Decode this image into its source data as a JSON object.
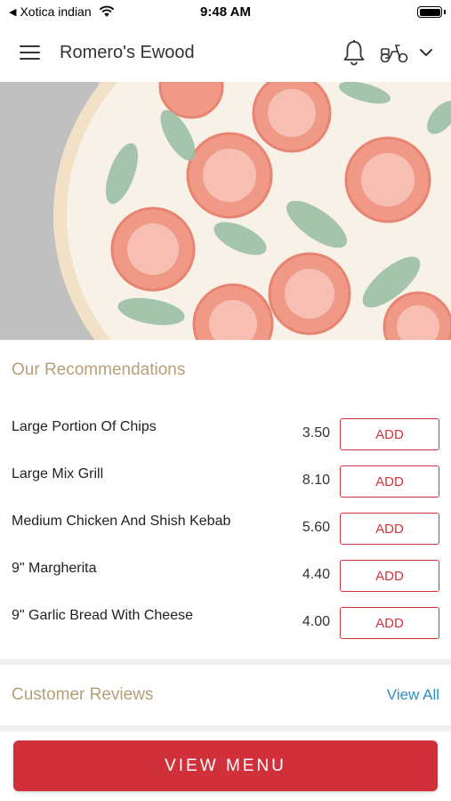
{
  "status_bar": {
    "back_label": "Xotica indian",
    "time": "9:48 AM",
    "battery_level": 1.0
  },
  "header": {
    "title": "Romero's Ewood",
    "icons": [
      "menu-icon",
      "bell-icon",
      "scooter-icon",
      "chevron-down-icon"
    ]
  },
  "recommendations": {
    "title": "Our Recommendations",
    "items": [
      {
        "name": "Large Portion Of Chips",
        "price": "3.50",
        "button": "ADD"
      },
      {
        "name": "Large Mix Grill",
        "price": "8.10",
        "button": "ADD"
      },
      {
        "name": "Medium Chicken And Shish Kebab",
        "price": "5.60",
        "button": "ADD"
      },
      {
        "name": "9\" Margherita",
        "price": "4.40",
        "button": "ADD"
      },
      {
        "name": "9\" Garlic Bread With Cheese",
        "price": "4.00",
        "button": "ADD"
      }
    ]
  },
  "reviews": {
    "title": "Customer Reviews",
    "view_all": "View All"
  },
  "footer": {
    "view_menu": "VIEW MENU"
  },
  "colors": {
    "accent": "#d0303a",
    "section_title": "#b5a078",
    "link": "#2b8fc0"
  }
}
